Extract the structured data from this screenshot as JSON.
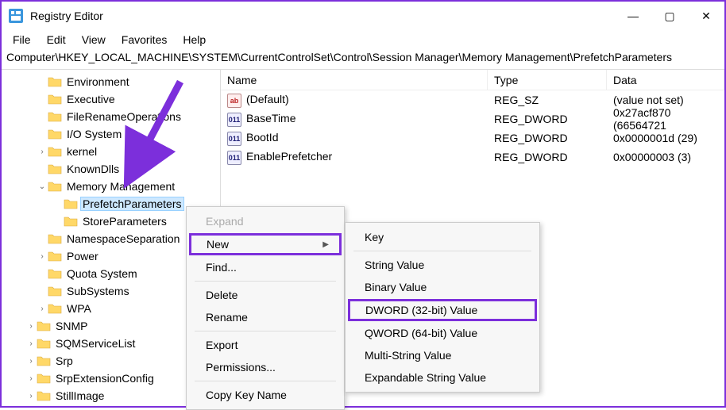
{
  "window": {
    "title": "Registry Editor"
  },
  "menu": {
    "file": "File",
    "edit": "Edit",
    "view": "View",
    "favorites": "Favorites",
    "help": "Help"
  },
  "path": "Computer\\HKEY_LOCAL_MACHINE\\SYSTEM\\CurrentControlSet\\Control\\Session Manager\\Memory Management\\PrefetchParameters",
  "tree": {
    "items": [
      {
        "label": "Environment",
        "indent": 44,
        "chev": ""
      },
      {
        "label": "Executive",
        "indent": 44,
        "chev": ""
      },
      {
        "label": "FileRenameOperations",
        "indent": 44,
        "chev": ""
      },
      {
        "label": "I/O System",
        "indent": 44,
        "chev": ""
      },
      {
        "label": "kernel",
        "indent": 44,
        "chev": "›"
      },
      {
        "label": "KnownDlls",
        "indent": 44,
        "chev": ""
      },
      {
        "label": "Memory Management",
        "indent": 44,
        "chev": "⌄",
        "expanded": true
      },
      {
        "label": "PrefetchParameters",
        "indent": 64,
        "chev": "",
        "selected": true
      },
      {
        "label": "StoreParameters",
        "indent": 64,
        "chev": ""
      },
      {
        "label": "NamespaceSeparation",
        "indent": 44,
        "chev": ""
      },
      {
        "label": "Power",
        "indent": 44,
        "chev": "›"
      },
      {
        "label": "Quota System",
        "indent": 44,
        "chev": ""
      },
      {
        "label": "SubSystems",
        "indent": 44,
        "chev": ""
      },
      {
        "label": "WPA",
        "indent": 44,
        "chev": "›"
      },
      {
        "label": "SNMP",
        "indent": 30,
        "chev": "›"
      },
      {
        "label": "SQMServiceList",
        "indent": 30,
        "chev": "›"
      },
      {
        "label": "Srp",
        "indent": 30,
        "chev": "›"
      },
      {
        "label": "SrpExtensionConfig",
        "indent": 30,
        "chev": "›"
      },
      {
        "label": "StillImage",
        "indent": 30,
        "chev": "›"
      }
    ]
  },
  "list": {
    "headers": {
      "name": "Name",
      "type": "Type",
      "data": "Data"
    },
    "rows": [
      {
        "icon": "str",
        "name": "(Default)",
        "type": "REG_SZ",
        "data": "(value not set)"
      },
      {
        "icon": "bin",
        "name": "BaseTime",
        "type": "REG_DWORD",
        "data": "0x27acf870 (66564721"
      },
      {
        "icon": "bin",
        "name": "BootId",
        "type": "REG_DWORD",
        "data": "0x0000001d (29)"
      },
      {
        "icon": "bin",
        "name": "EnablePrefetcher",
        "type": "REG_DWORD",
        "data": "0x00000003 (3)"
      }
    ]
  },
  "context": {
    "expand": "Expand",
    "new": "New",
    "find": "Find...",
    "delete": "Delete",
    "rename": "Rename",
    "export": "Export",
    "permissions": "Permissions...",
    "copykey": "Copy Key Name"
  },
  "submenu": {
    "key": "Key",
    "string": "String Value",
    "binary": "Binary Value",
    "dword": "DWORD (32-bit) Value",
    "qword": "QWORD (64-bit) Value",
    "multi": "Multi-String Value",
    "expand": "Expandable String Value"
  }
}
